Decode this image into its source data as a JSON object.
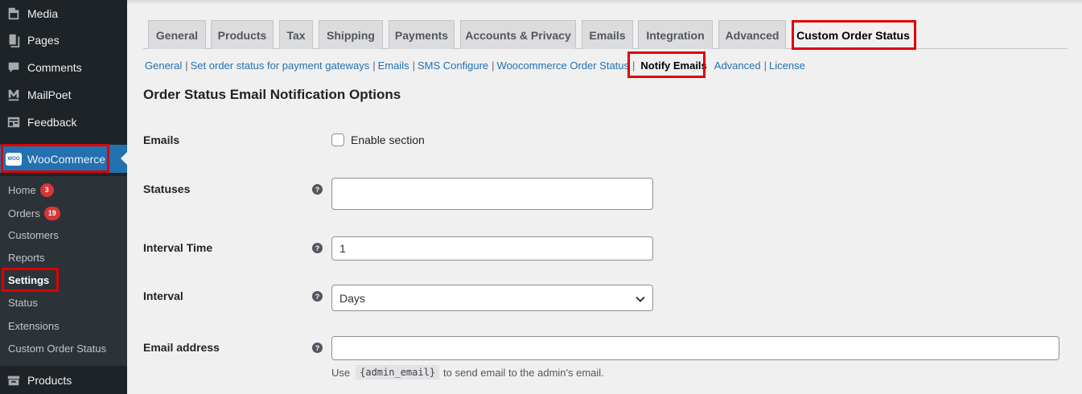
{
  "sidebar": {
    "menu": [
      {
        "label": "Media",
        "icon": "media-icon"
      },
      {
        "label": "Pages",
        "icon": "pages-icon"
      },
      {
        "label": "Comments",
        "icon": "comments-icon"
      },
      {
        "label": "MailPoet",
        "icon": "mailpoet-icon"
      },
      {
        "label": "Feedback",
        "icon": "feedback-icon"
      }
    ],
    "woocommerce": {
      "label": "WooCommerce",
      "icon_text": "WOO"
    },
    "submenu": [
      {
        "label": "Home",
        "badge": "3"
      },
      {
        "label": "Orders",
        "badge": "19"
      },
      {
        "label": "Customers"
      },
      {
        "label": "Reports"
      },
      {
        "label": "Settings"
      },
      {
        "label": "Status"
      },
      {
        "label": "Extensions"
      },
      {
        "label": "Custom Order Status"
      }
    ],
    "products": {
      "label": "Products"
    }
  },
  "tabs": [
    "General",
    "Products",
    "Tax",
    "Shipping",
    "Payments",
    "Accounts & Privacy",
    "Emails",
    "Integration",
    "Advanced",
    "Custom Order Status"
  ],
  "active_tab": "Custom Order Status",
  "subsections": [
    "General",
    "Set order status for payment gateways",
    "Emails",
    "SMS Configure",
    "Woocommerce Order Status",
    "Notify Emails",
    "Advanced",
    "License"
  ],
  "current_subsection": "Notify Emails",
  "form": {
    "title": "Order Status Email Notification Options",
    "emails": {
      "label": "Emails",
      "checkbox_label": "Enable section"
    },
    "statuses": {
      "label": "Statuses",
      "value": ""
    },
    "interval_time": {
      "label": "Interval Time",
      "value": "1"
    },
    "interval": {
      "label": "Interval",
      "value": "Days"
    },
    "email_address": {
      "label": "Email address",
      "value": "",
      "desc_prefix": "Use",
      "desc_code": "{admin_email}",
      "desc_suffix": "to send email to the admin's email."
    },
    "help_glyph": "?"
  },
  "colors": {
    "accent": "#2271b1",
    "highlight": "#e00000",
    "sidebar": "#1d2327"
  }
}
